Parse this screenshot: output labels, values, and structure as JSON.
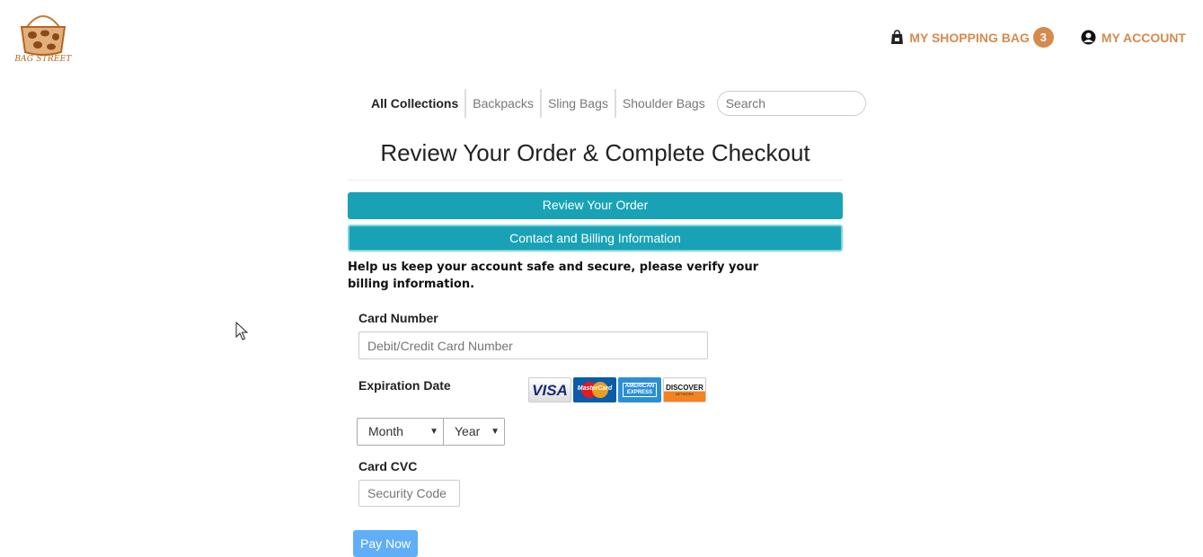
{
  "brand": {
    "logo_text": "BAG STREET",
    "accent_color": "#d68a4c"
  },
  "topnav": {
    "bag_label": "MY SHOPPING BAG",
    "bag_count": "3",
    "account_label": "MY ACCOUNT"
  },
  "collections": {
    "tabs": [
      "All Collections",
      "Backpacks",
      "Sling Bags",
      "Shoulder Bags"
    ],
    "search_placeholder": "Search"
  },
  "checkout": {
    "title": "Review Your Order & Complete Checkout",
    "review_bar": "Review Your Order",
    "billing_bar": "Contact and Billing Information",
    "bar_color": "#19a2b6",
    "notice": "Help us keep your account safe and secure, please verify your billing information."
  },
  "form": {
    "card_number_label": "Card Number",
    "card_number_placeholder": "Debit/Credit Card Number",
    "expiration_label": "Expiration Date",
    "month_value": "Month",
    "year_value": "Year",
    "cvc_label": "Card CVC",
    "cvc_placeholder": "Security Code",
    "pay_button": "Pay Now",
    "card_logos": {
      "visa": "VISA",
      "mastercard": "MasterCard",
      "amex": "AMERICAN EXPRESS",
      "discover": "DISCOVER",
      "discover_sub": "NETWORK"
    }
  }
}
